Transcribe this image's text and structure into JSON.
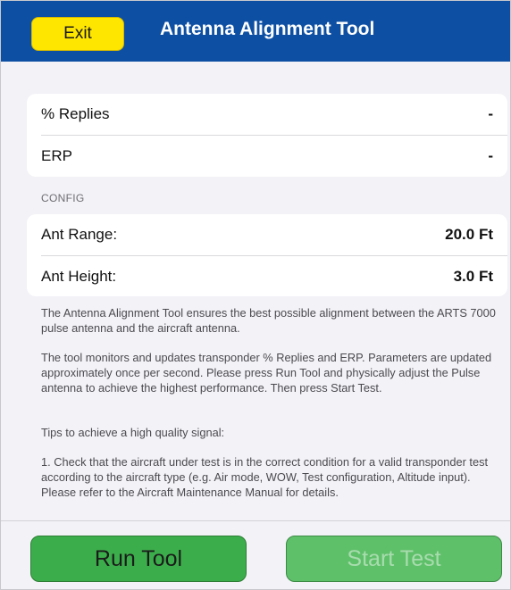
{
  "header": {
    "exit_label": "Exit",
    "title": "Antenna Alignment Tool"
  },
  "measurements": [
    {
      "label": "% Replies",
      "value": "-"
    },
    {
      "label": "ERP",
      "value": "-"
    }
  ],
  "config": {
    "section_label": "CONFIG",
    "rows": [
      {
        "label": "Ant Range:",
        "value": "20.0 Ft"
      },
      {
        "label": "Ant Height:",
        "value": "3.0 Ft"
      }
    ]
  },
  "description": {
    "p1": "The Antenna Alignment Tool ensures the best possible alignment between the ARTS 7000 pulse antenna and the aircraft antenna.",
    "p2": "The tool monitors and updates transponder % Replies and ERP. Parameters are updated approximately once per second. Please press Run Tool and physically adjust the Pulse antenna to achieve the highest performance. Then press Start Test.",
    "p3": "Tips to achieve a high quality signal:",
    "p4": "1. Check that the aircraft under test is in the correct condition for a valid transponder test according to the aircraft type (e.g. Air mode, WOW, Test configuration, Altitude input). Please refer to the Aircraft Maintenance Manual for details."
  },
  "footer": {
    "run_label": "Run Tool",
    "start_label": "Start Test",
    "start_enabled": false
  },
  "colors": {
    "header_bg": "#0d4fa3",
    "exit_bg": "#ffe600",
    "button_green": "#3bae4b"
  }
}
